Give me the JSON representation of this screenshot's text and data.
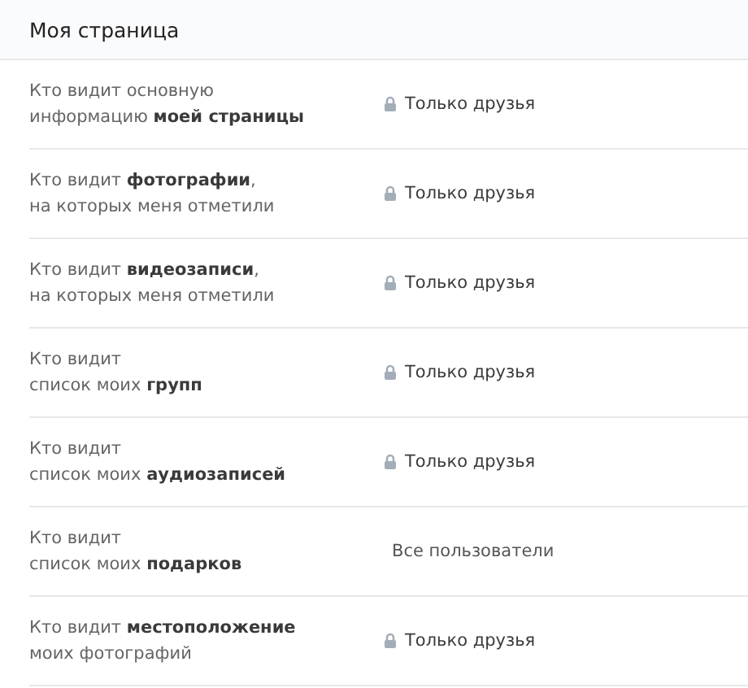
{
  "header": {
    "title": "Моя страница"
  },
  "settings": [
    {
      "lines": [
        "Кто видит основную",
        "информацию **моей страницы**"
      ],
      "value": "Только друзья",
      "locked": true
    },
    {
      "lines": [
        "Кто видит **фотографии**,",
        "на которых меня отметили"
      ],
      "value": "Только друзья",
      "locked": true
    },
    {
      "lines": [
        "Кто видит **видеозаписи**,",
        "на которых меня отметили"
      ],
      "value": "Только друзья",
      "locked": true
    },
    {
      "lines": [
        "Кто видит",
        "список моих **групп**"
      ],
      "value": "Только друзья",
      "locked": true
    },
    {
      "lines": [
        "Кто видит",
        "список моих **аудиозаписей**"
      ],
      "value": "Только друзья",
      "locked": true
    },
    {
      "lines": [
        "Кто видит",
        "список моих **подарков**"
      ],
      "value": "Все пользователи",
      "locked": false
    },
    {
      "lines": [
        "Кто видит **местоположение**",
        "моих фотографий"
      ],
      "value": "Только друзья",
      "locked": true
    }
  ]
}
